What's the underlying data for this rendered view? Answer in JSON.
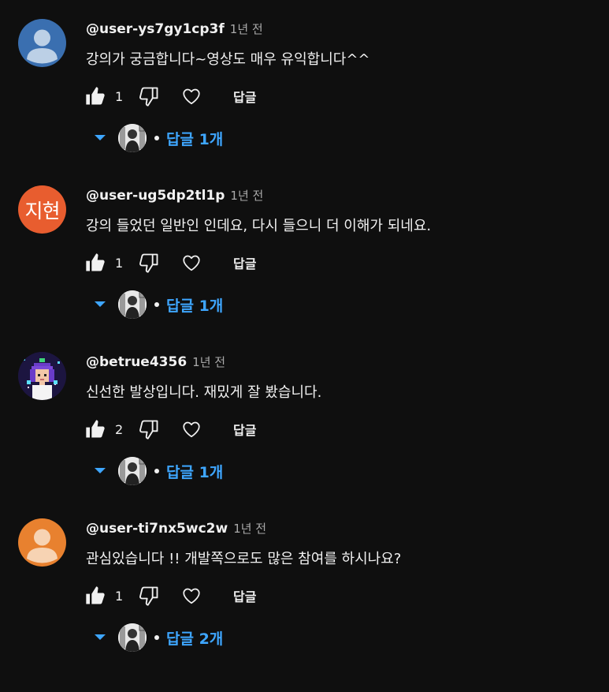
{
  "colors": {
    "background": "#0f0f0f",
    "text": "#f1f1f1",
    "muted": "#aaaaaa",
    "link": "#3ea6ff"
  },
  "comments": [
    {
      "author": "@user-ys7gy1cp3f",
      "time": "1년 전",
      "text": "강의가 궁금합니다~영상도 매우 유익합니다^^",
      "likes": "1",
      "reply_label": "답글",
      "replies_label": "답글 1개",
      "avatar": "default-blue-avatar"
    },
    {
      "author": "@user-ug5dp2tl1p",
      "time": "1년 전",
      "text": "강의 들었던 일반인 인데요, 다시 들으니 더 이해가 되네요.",
      "likes": "1",
      "reply_label": "답글",
      "replies_label": "답글 1개",
      "avatar": "initials-avatar",
      "avatar_text": "지현"
    },
    {
      "author": "@betrue4356",
      "time": "1년 전",
      "text": "신선한 발상입니다. 재밌게 잘 봤습니다.",
      "likes": "2",
      "reply_label": "답글",
      "replies_label": "답글 1개",
      "avatar": "pixel-art-avatar"
    },
    {
      "author": "@user-ti7nx5wc2w",
      "time": "1년 전",
      "text": "관심있습니다 !! 개발쪽으로도 많은 참여를 하시나요?",
      "likes": "1",
      "reply_label": "답글",
      "replies_label": "답글 2개",
      "avatar": "default-orange-avatar"
    }
  ]
}
